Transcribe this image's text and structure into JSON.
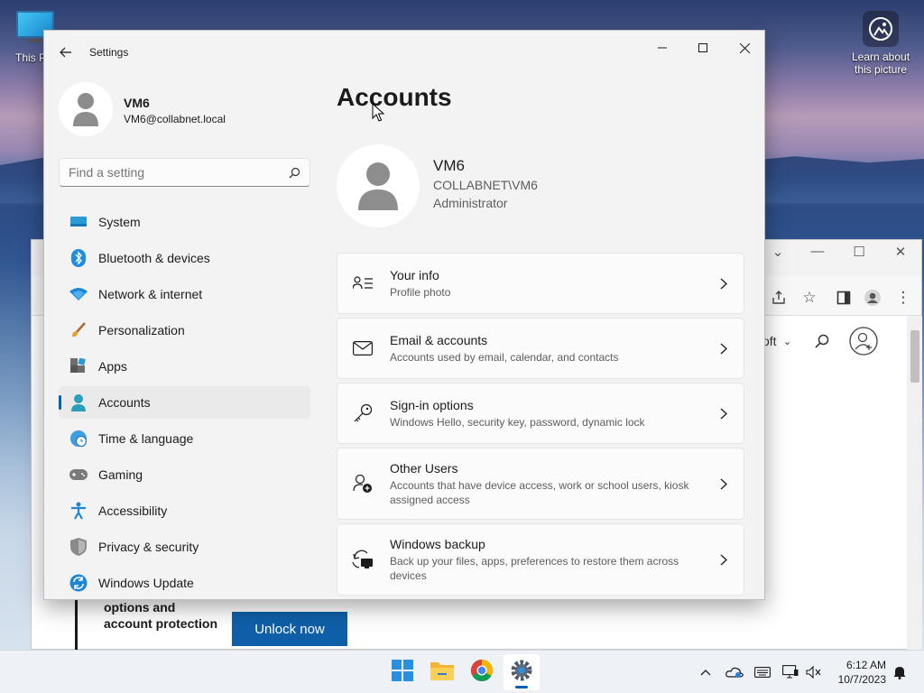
{
  "desktop": {
    "this_pc_label": "This PC",
    "learn_label": "Learn about this picture"
  },
  "browser": {
    "site_nav_1": "oft",
    "promo_text": "options and account protection",
    "unlock_button": "Unlock now"
  },
  "settings": {
    "app_title": "Settings",
    "user_name": "VM6",
    "user_email": "VM6@collabnet.local",
    "search_placeholder": "Find a setting",
    "nav": [
      {
        "label": "System",
        "icon": "system-icon"
      },
      {
        "label": "Bluetooth & devices",
        "icon": "bluetooth-icon"
      },
      {
        "label": "Network & internet",
        "icon": "wifi-icon"
      },
      {
        "label": "Personalization",
        "icon": "brush-icon"
      },
      {
        "label": "Apps",
        "icon": "apps-icon"
      },
      {
        "label": "Accounts",
        "icon": "accounts-icon",
        "active": true
      },
      {
        "label": "Time & language",
        "icon": "globe-clock-icon"
      },
      {
        "label": "Gaming",
        "icon": "gamepad-icon"
      },
      {
        "label": "Accessibility",
        "icon": "accessibility-icon"
      },
      {
        "label": "Privacy & security",
        "icon": "shield-icon"
      },
      {
        "label": "Windows Update",
        "icon": "update-icon"
      }
    ],
    "page_title": "Accounts",
    "account": {
      "name": "VM6",
      "domain": "COLLABNET\\VM6",
      "role": "Administrator"
    },
    "cards": [
      {
        "title": "Your info",
        "subtitle": "Profile photo",
        "icon": "contact-card-icon"
      },
      {
        "title": "Email & accounts",
        "subtitle": "Accounts used by email, calendar, and contacts",
        "icon": "mail-icon"
      },
      {
        "title": "Sign-in options",
        "subtitle": "Windows Hello, security key, password, dynamic lock",
        "icon": "key-icon"
      },
      {
        "title": "Other Users",
        "subtitle": "Accounts that have device access, work or school users, kiosk assigned access",
        "icon": "add-user-icon"
      },
      {
        "title": "Windows backup",
        "subtitle": "Back up your files, apps, preferences to restore them across devices",
        "icon": "backup-icon"
      }
    ]
  },
  "taskbar": {
    "time": "6:12 AM",
    "date": "10/7/2023",
    "apps": [
      "start-icon",
      "file-explorer-icon",
      "chrome-icon",
      "settings-icon"
    ]
  },
  "colors": {
    "accent": "#005fb8",
    "unlock_button": "#0f5fa8"
  }
}
